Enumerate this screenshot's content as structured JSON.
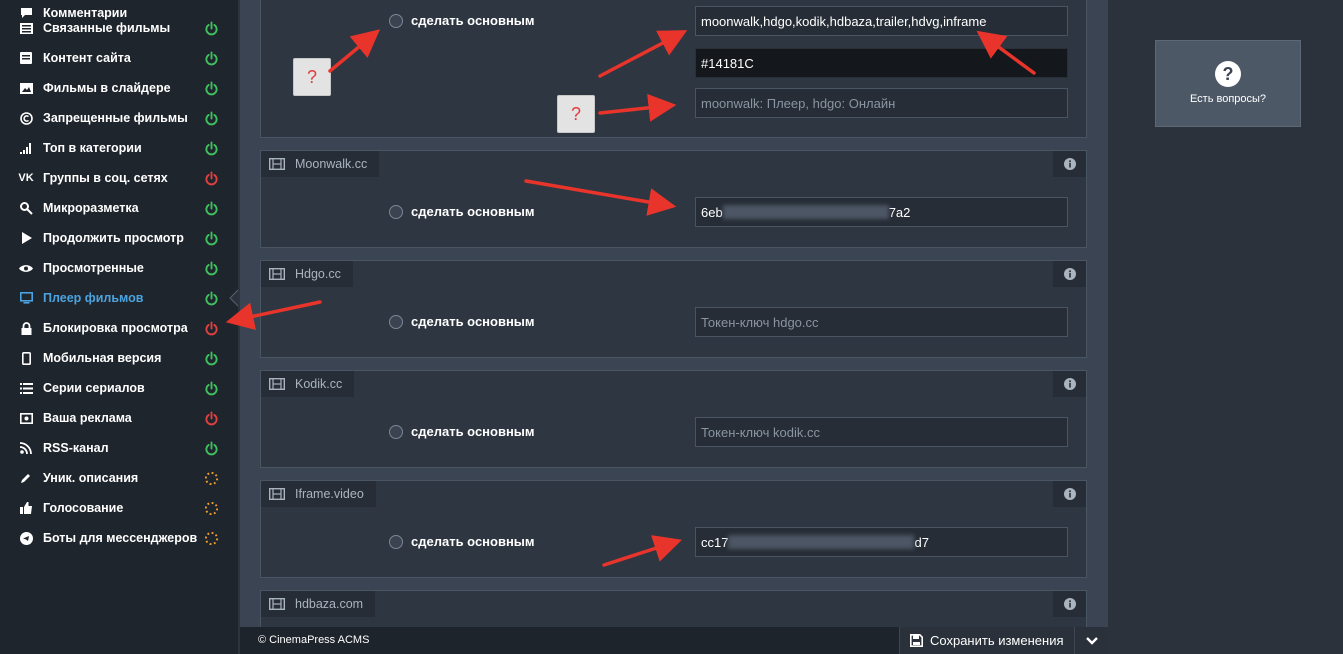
{
  "sidebar": {
    "items": [
      {
        "label": "Комментарии",
        "icon": "comments-icon",
        "status": "on"
      },
      {
        "label": "Связанные фильмы",
        "icon": "list-icon",
        "status": "on"
      },
      {
        "label": "Контент сайта",
        "icon": "content-icon",
        "status": "on"
      },
      {
        "label": "Фильмы в слайдере",
        "icon": "image-icon",
        "status": "on"
      },
      {
        "label": "Запрещенные фильмы",
        "icon": "copyright-icon",
        "status": "on"
      },
      {
        "label": "Топ в категории",
        "icon": "signal-icon",
        "status": "on"
      },
      {
        "label": "Группы в соц. сетях",
        "icon": "vk-icon",
        "status": "off"
      },
      {
        "label": "Микроразметка",
        "icon": "key-icon",
        "status": "on"
      },
      {
        "label": "Продолжить просмотр",
        "icon": "play-icon",
        "status": "on"
      },
      {
        "label": "Просмотренные",
        "icon": "eye-icon",
        "status": "on"
      },
      {
        "label": "Плеер фильмов",
        "icon": "monitor-icon",
        "status": "on",
        "active": true
      },
      {
        "label": "Блокировка просмотра",
        "icon": "lock-icon",
        "status": "off"
      },
      {
        "label": "Мобильная версия",
        "icon": "mobile-icon",
        "status": "on"
      },
      {
        "label": "Серии сериалов",
        "icon": "list-icon",
        "status": "on"
      },
      {
        "label": "Ваша реклама",
        "icon": "ad-icon",
        "status": "off"
      },
      {
        "label": "RSS-канал",
        "icon": "rss-icon",
        "status": "on"
      },
      {
        "label": "Уник. описания",
        "icon": "pencil-icon",
        "status": "loading"
      },
      {
        "label": "Голосование",
        "icon": "thumbs-up-icon",
        "status": "loading"
      },
      {
        "label": "Боты для мессенджеров",
        "icon": "telegram-icon",
        "status": "loading"
      }
    ]
  },
  "top_card": {
    "make_main_label": "сделать основным",
    "order_value": "moonwalk,hdgo,kodik,hdbaza,trailer,hdvg,inframe",
    "color_value": "#14181C",
    "names_placeholder": "moonwalk: Плеер, hdgo: Онлайн",
    "help_glyph": "?"
  },
  "players": [
    {
      "name": "Moonwalk.cc",
      "make_main_label": "сделать основным",
      "token_prefix": "6eb",
      "token_suffix": "7a2",
      "placeholder": ""
    },
    {
      "name": "Hdgo.cc",
      "make_main_label": "сделать основным",
      "token_prefix": "",
      "token_suffix": "",
      "placeholder": "Токен-ключ hdgo.cc"
    },
    {
      "name": "Kodik.cc",
      "make_main_label": "сделать основным",
      "token_prefix": "",
      "token_suffix": "",
      "placeholder": "Токен-ключ kodik.cc"
    },
    {
      "name": "Iframe.video",
      "make_main_label": "сделать основным",
      "token_prefix": "cc17",
      "token_suffix": "d7",
      "placeholder": ""
    },
    {
      "name": "hdbaza.com"
    }
  ],
  "footer": {
    "copyright": "© CinemaPress ACMS",
    "save_label": "Сохранить изменения"
  },
  "help": {
    "label": "Есть вопросы?",
    "glyph": "?"
  },
  "colors": {
    "status_on": "#3fbf5f",
    "status_off": "#e04040",
    "status_loading": "#f0a030",
    "accent": "#4aa3df",
    "annotation_arrow": "#e8342b"
  }
}
